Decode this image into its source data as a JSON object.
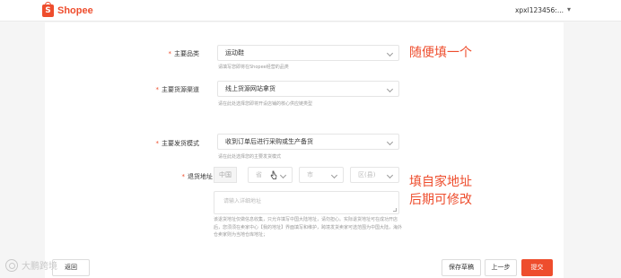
{
  "header": {
    "brand": "Shopee",
    "brand_initial": "S",
    "username": "xpxl123456:...",
    "caret": "▾"
  },
  "form": {
    "category": {
      "label": "主要品类",
      "value": "运动鞋",
      "hint": "请填写您即将在Shopee经营的品类"
    },
    "supply_channel": {
      "label": "主要货源渠道",
      "value": "线上货源网站拿货",
      "hint": "请在此处选择您即将开设店铺的核心供应链类型"
    },
    "shipping_mode": {
      "label": "主要发货模式",
      "value": "收到订单后进行采购或生产备货",
      "hint": "请在此处选择您的主要发货模式"
    },
    "return_address": {
      "label": "退货地址",
      "country": "中国",
      "province_placeholder": "省",
      "city_placeholder": "市",
      "district_placeholder": "区(县)",
      "detail_placeholder": "请输入详细地址",
      "note": "该退货地址仅做信息收集，只允许填写中国大陆地址，请勿担心。实际退货地址可在成功开店后，您须须在卖家中心【我的地址】界面填写和维护，跨境发货卖家可选范围为中国大陆，海外仓卖家则为当地仓库地址；"
    }
  },
  "annotations": {
    "first": "随便填一个",
    "second_line1": "填自家地址",
    "second_line2": "后期可修改"
  },
  "buttons": {
    "save_draft": "保存草稿",
    "prev": "上一步",
    "submit": "提交",
    "left_partial": "返回"
  },
  "watermark": {
    "text": "大鹏跨境"
  },
  "colors": {
    "brand": "#ee4d2d"
  }
}
